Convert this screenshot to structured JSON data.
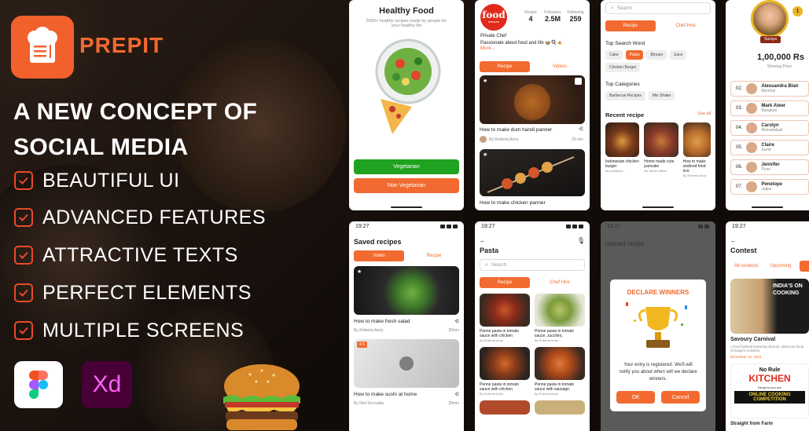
{
  "brand": {
    "name": "PREPIT",
    "accent": "#f2612c"
  },
  "hero": {
    "headline": "A NEW CONCEPT OF SOCIAL MEDIA"
  },
  "features": [
    "BEAUTIFUL UI",
    "ADVANCED FEATURES",
    "ATTRACTIVE TEXTS",
    "PERFECT ELEMENTS",
    "MULTIPLE SCREENS"
  ],
  "tools": {
    "xd_label": "Xd"
  },
  "screen1": {
    "title": "Healthy Food",
    "subtitle": "5000+ healthy recipes made by people for your healthy life",
    "veg": "Vegetarian",
    "nonveg": "Non Vegetarian",
    "veg_color": "#1fa21f"
  },
  "screen2": {
    "logo": "food",
    "logo_sub": "network",
    "stats": [
      {
        "label": "Recipe",
        "value": "4"
      },
      {
        "label": "Followers",
        "value": "2.5M"
      },
      {
        "label": "Following",
        "value": "259"
      }
    ],
    "role": "Private Chef",
    "bio": "Passionate about food and life 🍲🍳🍝",
    "more": "More...",
    "tabs": [
      "Recipe",
      "Videos"
    ],
    "cards": [
      {
        "title": "How to make dum handi panner",
        "author": "By Roberta Anny",
        "time": "20 min"
      },
      {
        "title": "How to make chicken panner"
      }
    ]
  },
  "screen3": {
    "search": "Search",
    "tabs": [
      "Recipe",
      "Chef Hire"
    ],
    "top_search_label": "Top Search Word",
    "top_search": [
      "Cake",
      "Pasta",
      "Biryani",
      "Juice",
      "Chicken Burger"
    ],
    "top_categories_label": "Top Categories",
    "categories": [
      "Barbecue Recipes",
      "Mix Shake"
    ],
    "recent_label": "Recent recipe",
    "see_all": "See all",
    "recent": [
      {
        "title": "Indonesian chicken burger",
        "author": "By Adrianna..."
      },
      {
        "title": "Home made cute pancake",
        "author": "By James Milner"
      },
      {
        "title": "How to make seafood fried rice",
        "author": "By Roberta Anny"
      }
    ]
  },
  "screen4": {
    "winner_name": "Suraya",
    "winner_rank": "1",
    "prize": "1,00,000 Rs",
    "prize_label": "Winning Price",
    "ranks": [
      {
        "pos": "02.",
        "name": "Alessandra Blair",
        "city": "Mumbai"
      },
      {
        "pos": "03.",
        "name": "Mark Ateer",
        "city": "Banglore"
      },
      {
        "pos": "04.",
        "name": "Carolyn",
        "city": "Ahmedabad"
      },
      {
        "pos": "05.",
        "name": "Claire",
        "city": "Surat"
      },
      {
        "pos": "06.",
        "name": "Jennifer",
        "city": "Pune"
      },
      {
        "pos": "07.",
        "name": "Penelope",
        "city": "Jaipur"
      }
    ]
  },
  "screen5": {
    "time": "19:27",
    "title": "Saved recipes",
    "tabs": [
      "Video",
      "Recipe"
    ],
    "cards": [
      {
        "title": "How to make fresh salad",
        "author": "By Roberta Anny",
        "time": "20min"
      },
      {
        "title": "How to make sushi at home",
        "author": "By Neil Soccadia",
        "time": "20min",
        "rating": "4.5"
      }
    ]
  },
  "screen6": {
    "time": "19:27",
    "title": "Pasta",
    "search": "Search",
    "tabs": [
      "Recipe",
      "Chef Hire"
    ],
    "items": [
      {
        "title": "Penne pasta in tomato sauce with chicken",
        "author": "By Roberta Anny"
      },
      {
        "title": "Penne pasta in tomato sauce, zucchini,",
        "author": "By Roberta Anny"
      },
      {
        "title": "Penne pasta in tomato sauce with chicken",
        "author": "By Roberta Anny"
      },
      {
        "title": "Penne pasta in tomato sauce with sausage.",
        "author": "By Roberta Anny"
      }
    ]
  },
  "screen7": {
    "time": "19:27",
    "bg_title": "Upload recipe",
    "dialog_title": "DECLARE WINNERS",
    "message": "Your entry is registered. We'll will notify you about when will we declare winners.",
    "ok": "OK",
    "cancel": "Cancel"
  },
  "screen8": {
    "time": "19:27",
    "title": "Contest",
    "tabs": [
      "All contests",
      "Upcoming",
      ""
    ],
    "items": [
      {
        "title": "Savoury Carnival",
        "desc": "A food festival featuring diverse, delicious local Chicago's cuisines.",
        "date": "December 20, 2024",
        "banner": "INDIA'S ON COOKING"
      },
      {
        "title": "Straight from Farm",
        "banner_top": "No Rule",
        "banner_mid": "KITCHEN",
        "banner_sub": "things to you are",
        "banner_bottom": "ONLINE COOKING COMPETITION"
      }
    ]
  }
}
